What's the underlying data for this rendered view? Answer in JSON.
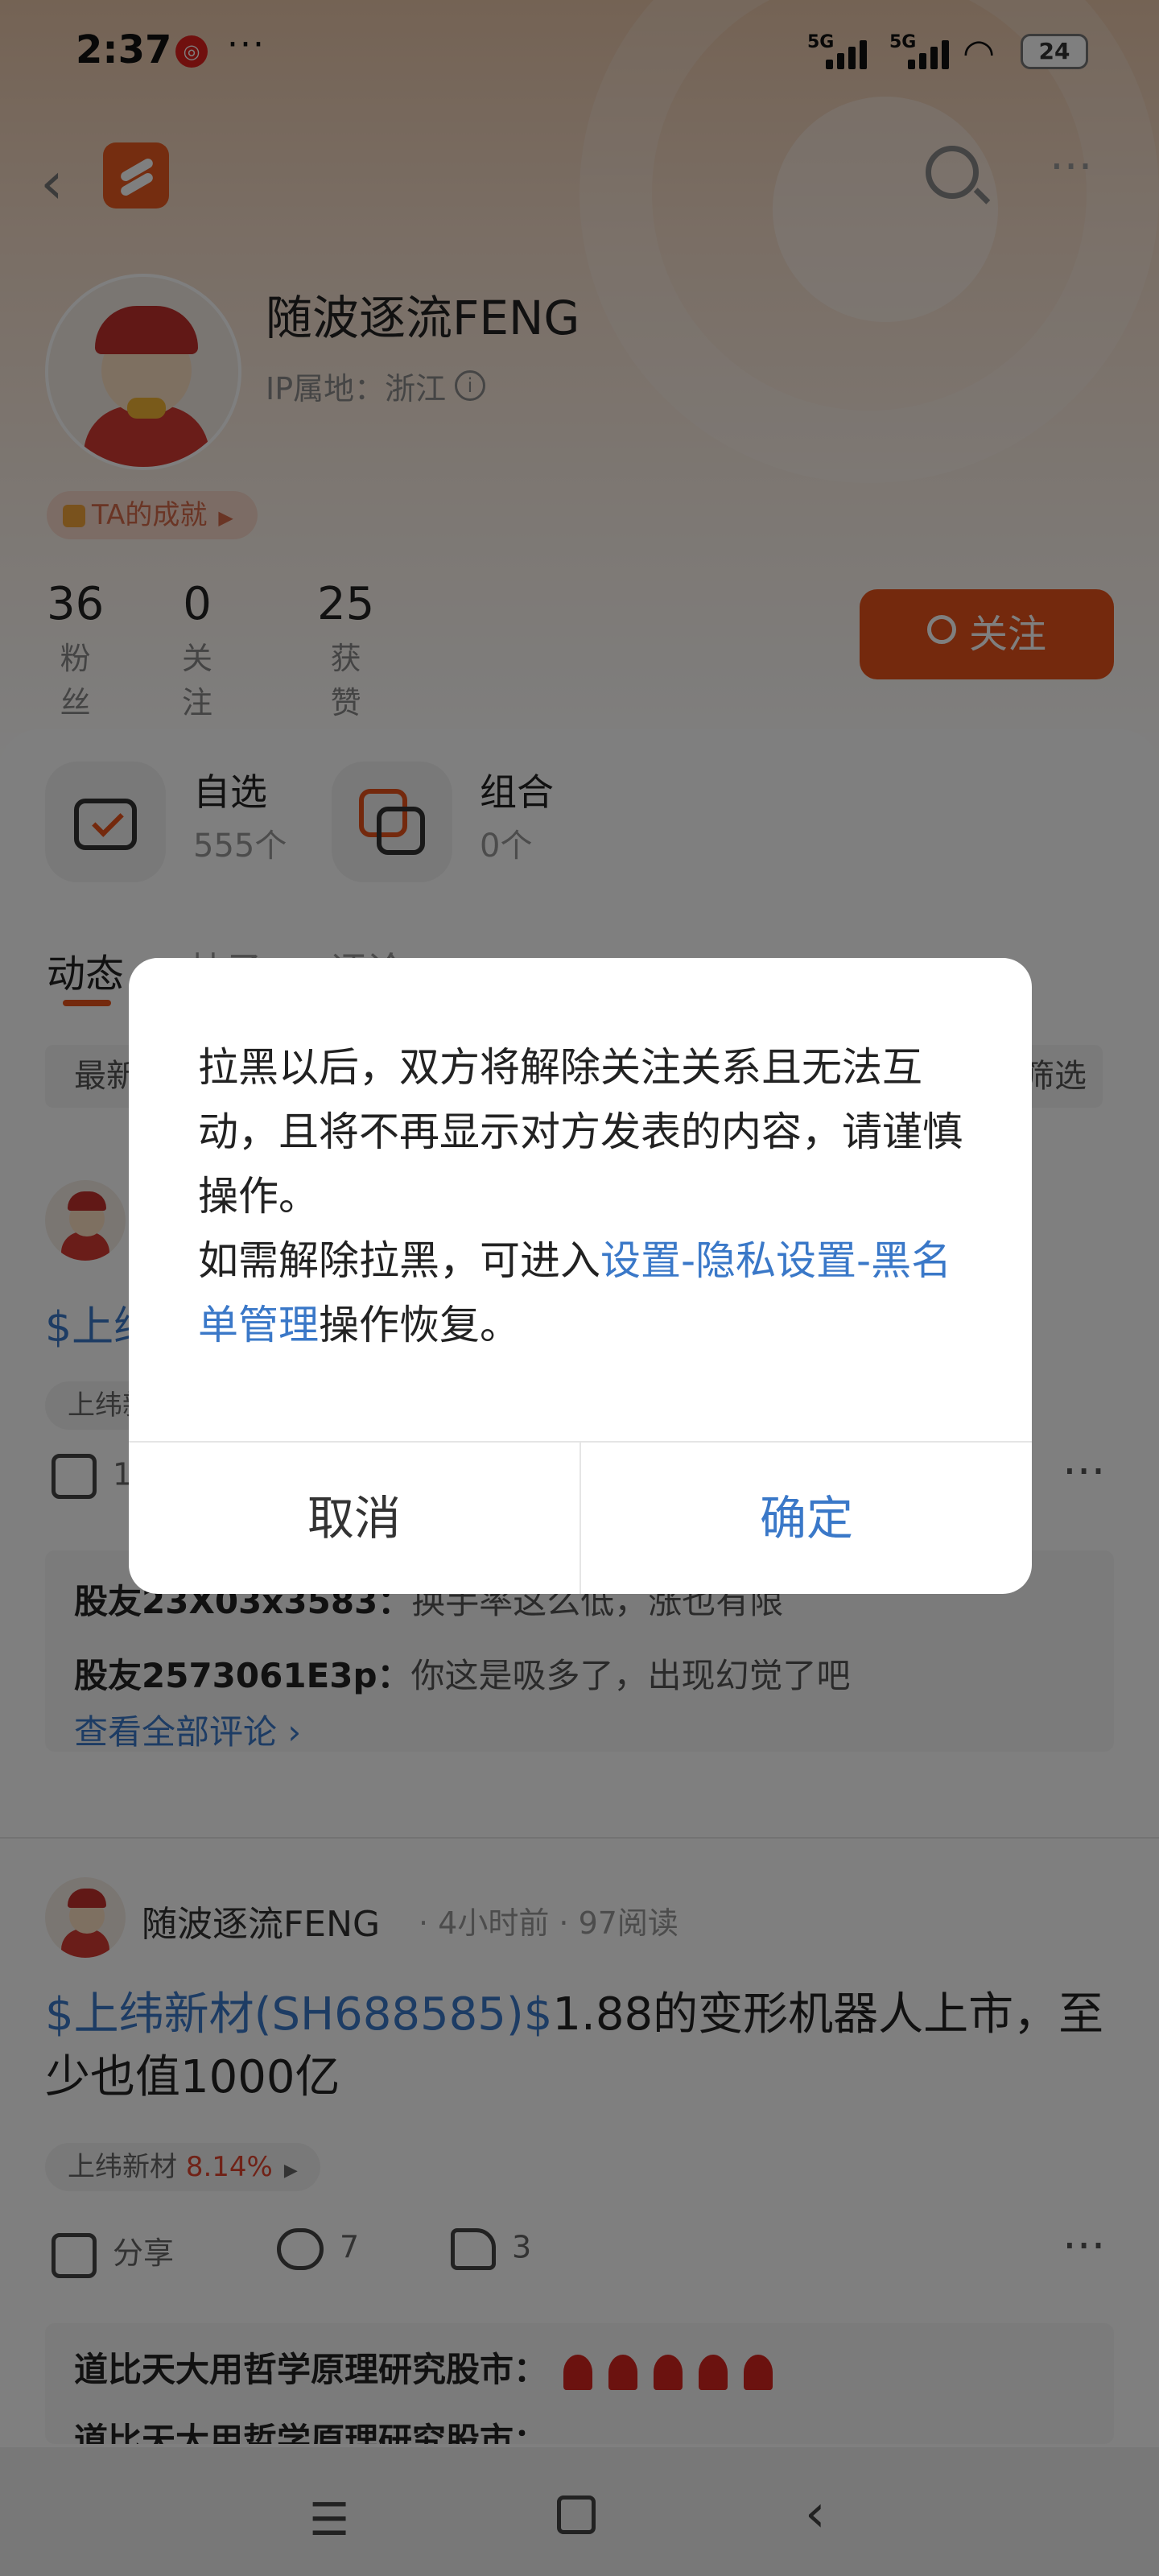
{
  "status_bar": {
    "time": "2:37",
    "notif_icon": "app-notification-icon",
    "dots": "···",
    "signal1": "5G",
    "signal2": "5G",
    "battery": "24"
  },
  "profile": {
    "name": "随波逐流FENG",
    "ip": "IP属地：浙江",
    "achievement": "TA的成就",
    "stats": [
      {
        "value": "36",
        "label": "粉丝"
      },
      {
        "value": "0",
        "label": "关注"
      },
      {
        "value": "25",
        "label": "获赞"
      }
    ],
    "follow_label": "关注"
  },
  "tiles": [
    {
      "title": "自选",
      "sub": "555个"
    },
    {
      "title": "组合",
      "sub": "0个"
    }
  ],
  "tabs": {
    "active": "动态",
    "others": [
      "帖子",
      "评论"
    ]
  },
  "filters": {
    "left": "最新",
    "right": "筛选"
  },
  "post1": {
    "title_prefix": "$上纬",
    "stock_chip": "上纬新",
    "share_count": "1",
    "comments": [
      {
        "user": "股友23X03x3583：",
        "text": "换手率这么低，涨也有限"
      },
      {
        "user": "股友2573061E3p：",
        "text": "你这是吸多了，出现幻觉了吧"
      }
    ],
    "see_all": "查看全部评论 ›"
  },
  "post2": {
    "user": "随波逐流FENG",
    "meta": "· 4小时前 · 97阅读",
    "stock_link": "$上纬新材(SH688585)$",
    "text_rest": "1.88的变形机器人上市，至少也值1000亿",
    "stock_chip_name": "上纬新材",
    "stock_chip_pct": "8.14%",
    "share_label": "分享",
    "comment_count": "7",
    "like_count": "3",
    "comments": [
      {
        "user": "道比天大用哲学原理研究股市：",
        "text": ""
      },
      {
        "user": "道比天大用哲学原理研究股市：",
        "text": ""
      }
    ]
  },
  "dialog": {
    "message_part1": "拉黑以后，双方将解除关注关系且无法互动，且将不再显示对方发表的内容，请谨慎操作。",
    "message_part2_prefix": "如需解除拉黑，可进入",
    "message_link": "设置-隐私设置-黑名单管理",
    "message_part2_suffix": "操作恢复。",
    "cancel_label": "取消",
    "confirm_label": "确定"
  },
  "colors": {
    "accent": "#e9531a",
    "link": "#3a78c8",
    "rise": "#e0442e"
  }
}
